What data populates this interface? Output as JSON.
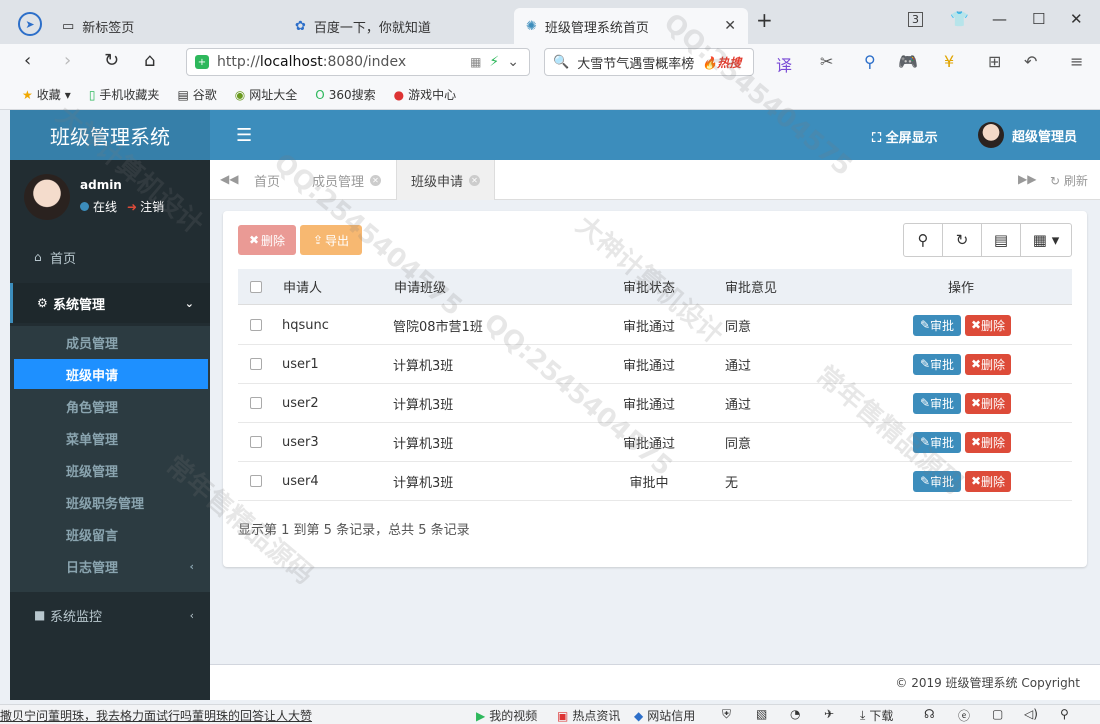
{
  "browser": {
    "tabs": [
      {
        "label": "新标签页",
        "icon": "tab-page-icon"
      },
      {
        "label": "百度一下，你就知道",
        "icon": "baidu-paw-icon"
      },
      {
        "label": "班级管理系统首页",
        "icon": "tab-favicon-icon",
        "close": "✕"
      }
    ],
    "new_tab": "+",
    "url_prefix": "http://",
    "url_host": "localhost",
    "url_rest": ":8080/index",
    "search_text": "大雪节气遇雪概率榜",
    "search_hot": "热搜",
    "tab_count": "3",
    "bookmarks": [
      "收藏",
      "手机收藏夹",
      "谷歌",
      "网址大全",
      "360搜索",
      "游戏中心"
    ]
  },
  "app": {
    "logo": "班级管理系统",
    "fullscreen": "全屏显示",
    "user_top": "超级管理员",
    "user": {
      "name": "admin",
      "status": "在线",
      "logout": "注销"
    },
    "menu": {
      "home": "首页",
      "system": "系统管理",
      "subitems": [
        "成员管理",
        "班级申请",
        "角色管理",
        "菜单管理",
        "班级管理",
        "班级职务管理",
        "班级留言",
        "日志管理"
      ],
      "monitor": "系统监控"
    },
    "content_tabs": [
      "首页",
      "成员管理",
      "班级申请"
    ],
    "refresh": "刷新",
    "toolbar": {
      "delete": "删除",
      "export": "导出"
    },
    "table": {
      "headers": [
        "申请人",
        "申请班级",
        "审批状态",
        "审批意见",
        "操作"
      ],
      "rows": [
        {
          "applicant": "hqsunc",
          "class": "管院08市营1班",
          "status": "审批通过",
          "opinion": "同意"
        },
        {
          "applicant": "user1",
          "class": "计算机3班",
          "status": "审批通过",
          "opinion": "通过"
        },
        {
          "applicant": "user2",
          "class": "计算机3班",
          "status": "审批通过",
          "opinion": "通过"
        },
        {
          "applicant": "user3",
          "class": "计算机3班",
          "status": "审批通过",
          "opinion": "同意"
        },
        {
          "applicant": "user4",
          "class": "计算机3班",
          "status": "审批中",
          "opinion": "无"
        }
      ],
      "approve_label": "审批",
      "delete_label": "删除"
    },
    "summary": "显示第 1 到第 5 条记录，总共 5 条记录",
    "footer": "© 2019 班级管理系统 Copyright"
  },
  "statusbar": {
    "news": "撒贝宁问董明珠，我去格力面试行吗董明珠的回答让人大赞",
    "items": [
      "我的视频",
      "热点资讯",
      "网站信用",
      "下载"
    ]
  },
  "watermarks": [
    "大神计算机设计",
    "QQ:2545404575",
    "常年售精品源码"
  ],
  "colors": {
    "header": "#3c8dbc",
    "sidebar": "#222d32",
    "active_menu": "#1e90ff",
    "danger": "#dd4b39"
  }
}
